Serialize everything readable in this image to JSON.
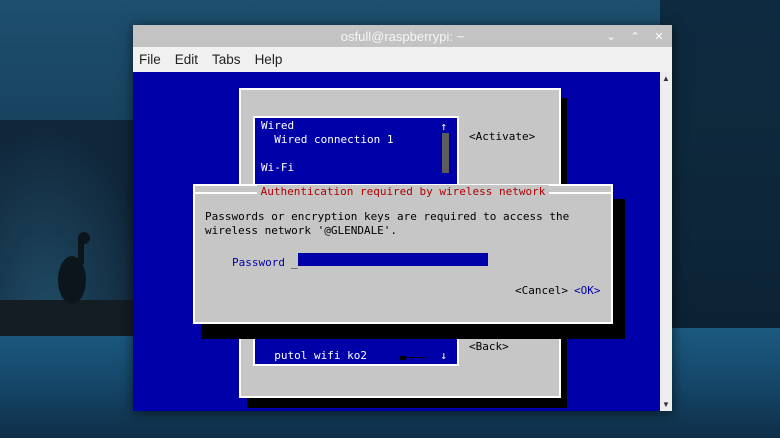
{
  "window": {
    "title": "osfull@raspberrypi: ~",
    "controls": {
      "minimize": "⌄",
      "maximize": "⌃",
      "close": "✕"
    }
  },
  "menubar": [
    "File",
    "Edit",
    "Tabs",
    "Help"
  ],
  "nmtui": {
    "list": {
      "section_wired": "Wired",
      "wired_connection": "  Wired connection 1",
      "section_wifi": "Wi-Fi",
      "last_item": "  putol wifi ko2",
      "scroll_up_arrow": "↑",
      "scroll_down_arrow": "↓"
    },
    "activate_button": "<Activate>",
    "back_button": "<Back>"
  },
  "auth_dialog": {
    "title": "Authentication required by wireless network",
    "message_line1": "Passwords or encryption keys are required to access the",
    "message_line2": "wireless network '@GLENDALE'.",
    "password_label": "Password",
    "password_prefix": "_",
    "password_value": "",
    "cancel_button": "<Cancel>",
    "ok_button": "<OK>"
  },
  "colors": {
    "terminal_bg": "#0000a8",
    "dialog_bg": "#c6c6c6",
    "title_red": "#b00000"
  }
}
